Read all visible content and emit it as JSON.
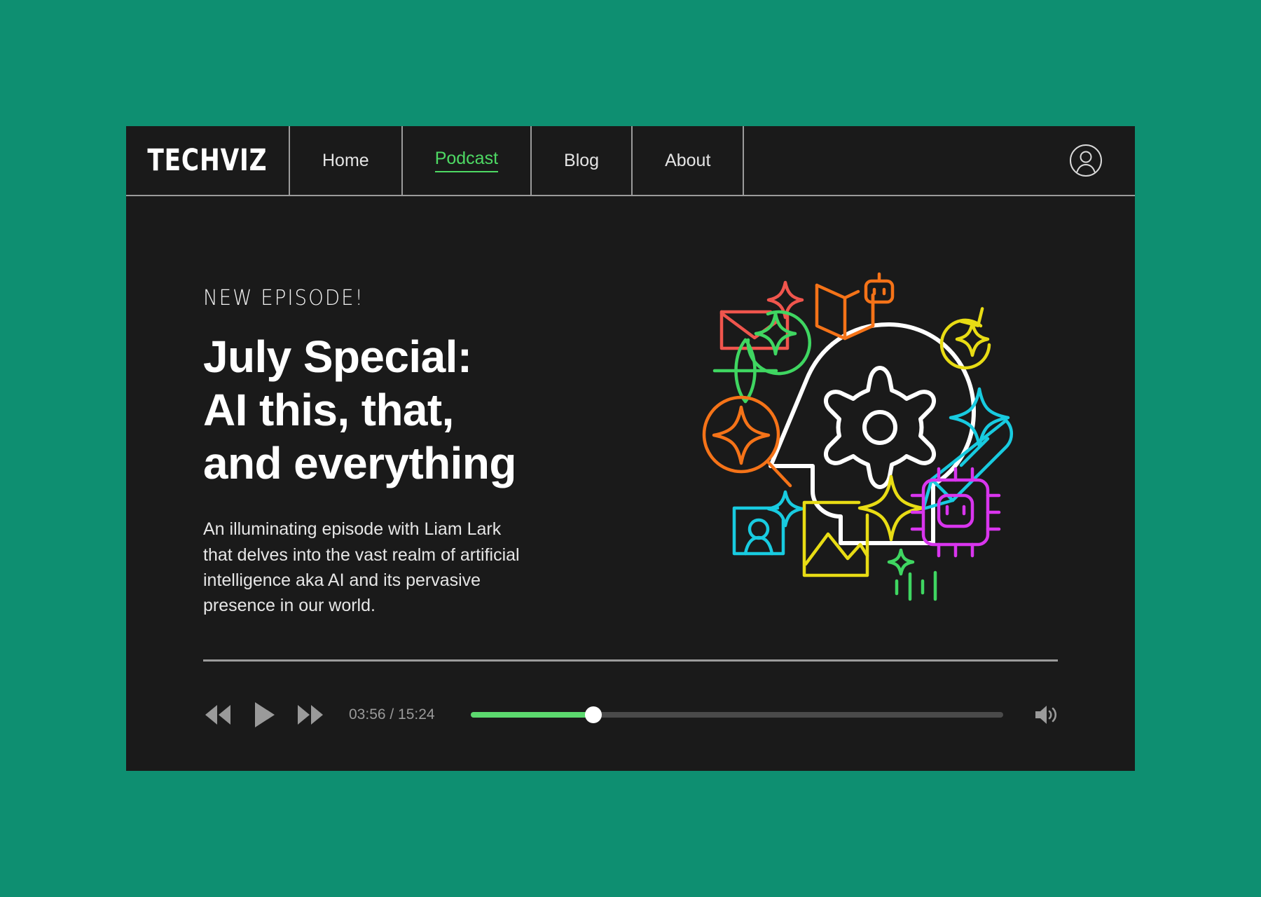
{
  "page": {
    "background_color": "#0E8F71",
    "card_background": "#1a1a1a"
  },
  "header": {
    "logo": "TECHVIZ",
    "nav": [
      {
        "label": "Home",
        "active": false
      },
      {
        "label": "Podcast",
        "active": true
      },
      {
        "label": "Blog",
        "active": false
      },
      {
        "label": "About",
        "active": false
      }
    ],
    "account_icon": "user-circle-icon",
    "active_color": "#4ed964"
  },
  "hero": {
    "eyebrow": "NEW EPISODE!",
    "title": "July Special:\nAI this, that,\nand everything",
    "description": "An illuminating episode with Liam Lark\nthat delves into the vast realm of artificial\nintelligence aka AI and its pervasive\npresence in our world."
  },
  "illustration": {
    "icons": [
      {
        "name": "envelope-sparkle-icon",
        "color": "#f0554d"
      },
      {
        "name": "map-robot-icon",
        "color": "#f57318"
      },
      {
        "name": "globe-sparkle-icon",
        "color": "#3fd661"
      },
      {
        "name": "refresh-sparkle-icon",
        "color": "#e8dc14"
      },
      {
        "name": "head-gear-icon",
        "color": "#ffffff"
      },
      {
        "name": "sparkle-icon",
        "color": "#18cbe0"
      },
      {
        "name": "pencil-icon",
        "color": "#18cbe0"
      },
      {
        "name": "search-sparkle-icon",
        "color": "#f57318"
      },
      {
        "name": "profile-photo-icon",
        "color": "#18cbe0"
      },
      {
        "name": "image-icon",
        "color": "#e8dc14"
      },
      {
        "name": "sparkle-large-icon",
        "color": "#e8dc14"
      },
      {
        "name": "chip-robot-icon",
        "color": "#d935ee"
      },
      {
        "name": "audio-wave-icon",
        "color": "#3fd661"
      }
    ]
  },
  "player": {
    "rewind_icon": "rewind-icon",
    "play_icon": "play-icon",
    "forward_icon": "fast-forward-icon",
    "volume_icon": "volume-icon",
    "current_time": "03:56",
    "total_time": "15:24",
    "time_display": "03:56 / 15:24",
    "progress_percent": 23,
    "progress_color": "#5cd96e",
    "track_color": "#4a4a4a"
  }
}
